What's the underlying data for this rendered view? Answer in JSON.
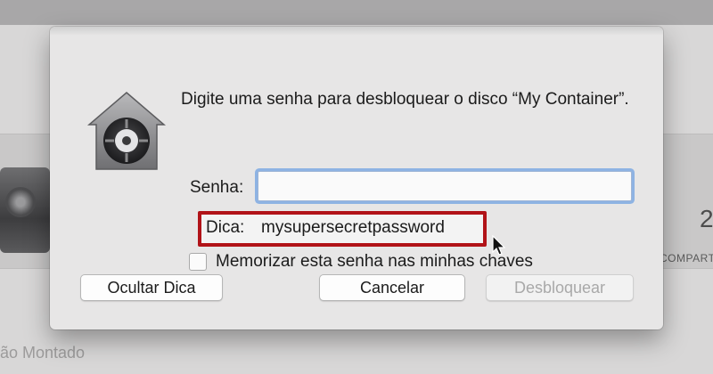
{
  "background": {
    "right_value": "2",
    "right_label": "COMPART",
    "bottom_text": "ão Montado"
  },
  "dialog": {
    "prompt": "Digite uma senha para desbloquear o disco “My Container”.",
    "password": {
      "label": "Senha:",
      "value": ""
    },
    "hint": {
      "label": "Dica:",
      "value": "mysupersecretpassword"
    },
    "remember": {
      "label": "Memorizar esta senha nas minhas chaves",
      "checked": false
    },
    "buttons": {
      "hide_hint": "Ocultar Dica",
      "cancel": "Cancelar",
      "unlock": "Desbloquear"
    }
  },
  "colors": {
    "highlight_border": "#b11318",
    "focus_ring": "#8eb3e3",
    "dialog_bg": "#e7e6e6"
  },
  "icons": [
    "lock-icon",
    "checkbox-icon",
    "pointer-cursor-icon"
  ]
}
